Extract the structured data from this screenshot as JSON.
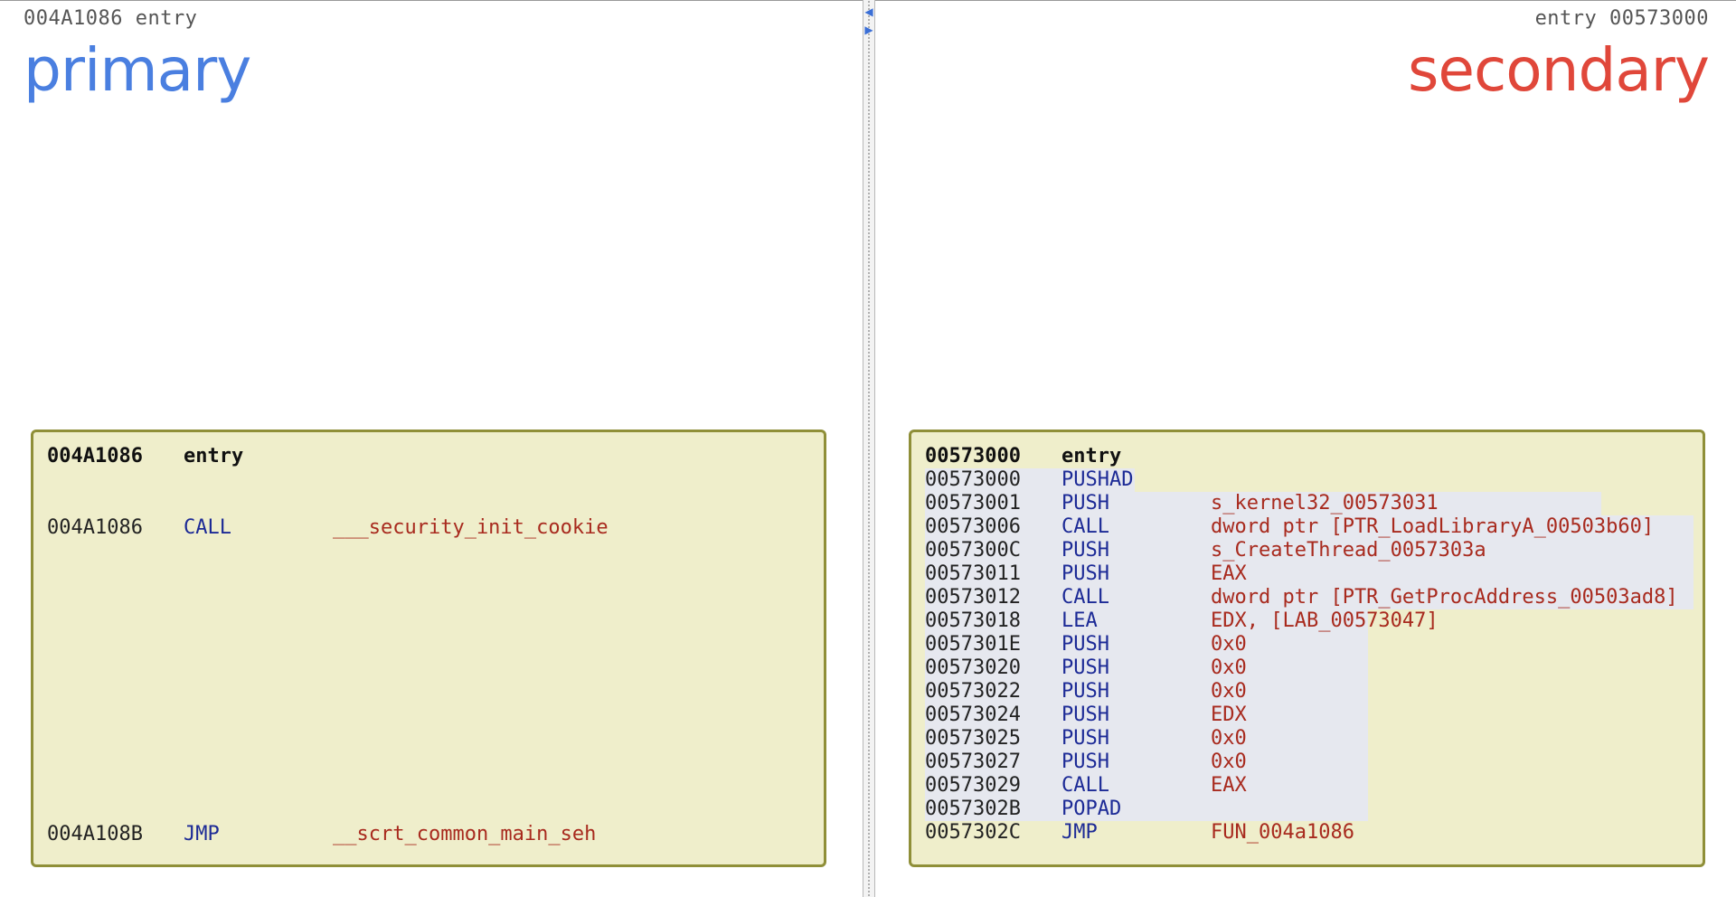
{
  "primary": {
    "header": "004A1086 entry",
    "title": "primary",
    "block": {
      "label_addr": "004A1086",
      "label": "entry",
      "rows": [
        {
          "addr": "004A1086",
          "mnemonic": "CALL",
          "operand": "___security_init_cookie"
        },
        {
          "addr": "004A108B",
          "mnemonic": "JMP",
          "operand": "__scrt_common_main_seh"
        }
      ]
    }
  },
  "secondary": {
    "header": "entry 00573000",
    "title": "secondary",
    "block": {
      "label_addr": "00573000",
      "label": "entry",
      "rows": [
        {
          "addr": "00573000",
          "mnemonic": "PUSHAD",
          "operand": ""
        },
        {
          "addr": "00573001",
          "mnemonic": "PUSH",
          "operand": "s_kernel32_00573031"
        },
        {
          "addr": "00573006",
          "mnemonic": "CALL",
          "operand": "dword ptr [PTR_LoadLibraryA_00503b60]"
        },
        {
          "addr": "0057300C",
          "mnemonic": "PUSH",
          "operand": "s_CreateThread_0057303a"
        },
        {
          "addr": "00573011",
          "mnemonic": "PUSH",
          "operand": "EAX"
        },
        {
          "addr": "00573012",
          "mnemonic": "CALL",
          "operand": "dword ptr [PTR_GetProcAddress_00503ad8]"
        },
        {
          "addr": "00573018",
          "mnemonic": "LEA",
          "operand": "EDX, [LAB_00573047]"
        },
        {
          "addr": "0057301E",
          "mnemonic": "PUSH",
          "operand": "0x0"
        },
        {
          "addr": "00573020",
          "mnemonic": "PUSH",
          "operand": "0x0"
        },
        {
          "addr": "00573022",
          "mnemonic": "PUSH",
          "operand": "0x0"
        },
        {
          "addr": "00573024",
          "mnemonic": "PUSH",
          "operand": "EDX"
        },
        {
          "addr": "00573025",
          "mnemonic": "PUSH",
          "operand": "0x0"
        },
        {
          "addr": "00573027",
          "mnemonic": "PUSH",
          "operand": "0x0"
        },
        {
          "addr": "00573029",
          "mnemonic": "CALL",
          "operand": "EAX"
        },
        {
          "addr": "0057302B",
          "mnemonic": "POPAD",
          "operand": ""
        },
        {
          "addr": "0057302C",
          "mnemonic": "JMP",
          "operand": "FUN_004a1086"
        }
      ]
    }
  },
  "divider": {
    "collapse_left_icon": "chevron-left-icon",
    "collapse_right_icon": "chevron-right-icon"
  }
}
